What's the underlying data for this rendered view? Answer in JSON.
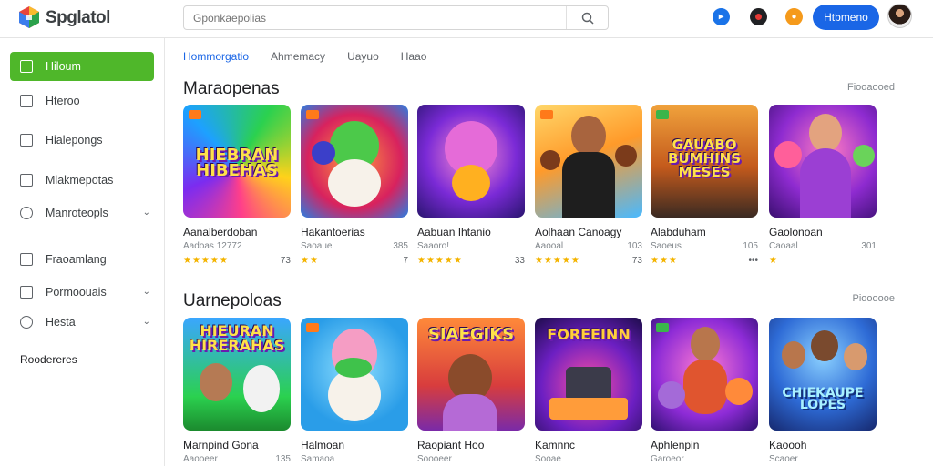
{
  "header": {
    "brand": "Spglatol",
    "search_placeholder": "Gponkaepolias",
    "signin_label": "Htbmeno",
    "icons": [
      "play-icon",
      "record-icon",
      "coin-icon"
    ]
  },
  "sidebar": {
    "items": [
      {
        "label": "Hiloum",
        "active": true
      },
      {
        "label": "Hteroo"
      },
      {
        "label": "Hialepongs"
      },
      {
        "label": "Mlakmepotas"
      },
      {
        "label": "Manroteopls",
        "chevron": true
      },
      {
        "label": "Fraoamlang"
      },
      {
        "label": "Pormoouais",
        "chevron": true
      },
      {
        "label": "Hesta",
        "chevron": true
      }
    ],
    "section_label": "Roodereres"
  },
  "tabs": [
    "Hommorgatio",
    "Ahmemacy",
    "Uayuo",
    "Haao"
  ],
  "sections": [
    {
      "title": "Maraopenas",
      "more": "Fiooaooed",
      "games": [
        {
          "title": "Aanalberdoban",
          "dev": "Aadoas 12772",
          "meta": "",
          "stars": "★★★★★",
          "count": "73",
          "art": "HIEBRAN HIBEHAS"
        },
        {
          "title": "Hakantoerias",
          "dev": "Saoaue",
          "meta": "385",
          "stars": "★★",
          "count": "7",
          "art": ""
        },
        {
          "title": "Aabuan Ihtanio",
          "dev": "Saaoro!",
          "meta": "",
          "stars": "★★★★★",
          "count": "33",
          "art": ""
        },
        {
          "title": "Aolhaan Canoagy",
          "dev": "Aaooal",
          "meta": "103",
          "stars": "★★★★★",
          "count": "73",
          "art": ""
        },
        {
          "title": "Alabduham",
          "dev": "Saoeus",
          "meta": "105",
          "stars": "★★★",
          "count": "•••",
          "art": "GAUABO BUMHINS MESES"
        },
        {
          "title": "Gaolonoan",
          "dev": "Caoaal",
          "meta": "301",
          "stars": "★",
          "count": "",
          "art": ""
        }
      ]
    },
    {
      "title": "Uarnepoloas",
      "more": "Pioooooe",
      "games": [
        {
          "title": "Marnpind Gona",
          "dev": "Aaooeer",
          "meta": "135",
          "art": "HIEURAN HIRERAHAS"
        },
        {
          "title": "Halmoan",
          "dev": "Samaoa",
          "meta": "",
          "art": ""
        },
        {
          "title": "Raopiant Hoo",
          "dev": "Soooeer",
          "meta": "",
          "art": "SIAEGIKS"
        },
        {
          "title": "Kamnnc",
          "dev": "Sooae",
          "meta": "",
          "art": "FOREEINN"
        },
        {
          "title": "Aphlenpin",
          "dev": "Garoeor",
          "meta": "",
          "art": ""
        },
        {
          "title": "Kaoooh",
          "dev": "Scaoer",
          "meta": "",
          "art": "CHIEKAUPE LOPES"
        }
      ]
    }
  ],
  "colors": {
    "accent_green": "#4fb72a",
    "accent_blue": "#1a66e6",
    "star": "#f4b400"
  }
}
